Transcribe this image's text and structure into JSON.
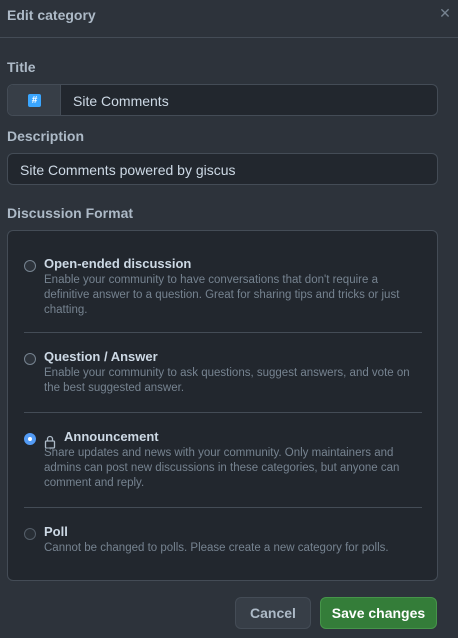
{
  "dialog": {
    "title": "Edit category",
    "close_icon": "close-icon"
  },
  "title_field": {
    "label": "Title",
    "emoji": "#",
    "value": "Site Comments"
  },
  "description_field": {
    "label": "Description",
    "value": "Site Comments powered by giscus"
  },
  "discussion_format": {
    "label": "Discussion Format",
    "options": [
      {
        "title": "Open-ended discussion",
        "description": "Enable your community to have conversations that don't require a definitive answer to a question. Great for sharing tips and tricks or just chatting.",
        "checked": false
      },
      {
        "title": "Question / Answer",
        "description": "Enable your community to ask questions, suggest answers, and vote on the best suggested answer.",
        "checked": false
      },
      {
        "title": "Announcement",
        "description": "Share updates and news with your community. Only maintainers and admins can post new discussions in these categories, but anyone can comment and reply.",
        "checked": true,
        "icon": "lock-icon"
      },
      {
        "title": "Poll",
        "description": "Cannot be changed to polls. Please create a new category for polls.",
        "checked": false
      }
    ]
  },
  "buttons": {
    "cancel": "Cancel",
    "save": "Save changes"
  },
  "colors": {
    "background": "#2d333b",
    "accent": "#539bf5",
    "save_button": "#347d39"
  }
}
